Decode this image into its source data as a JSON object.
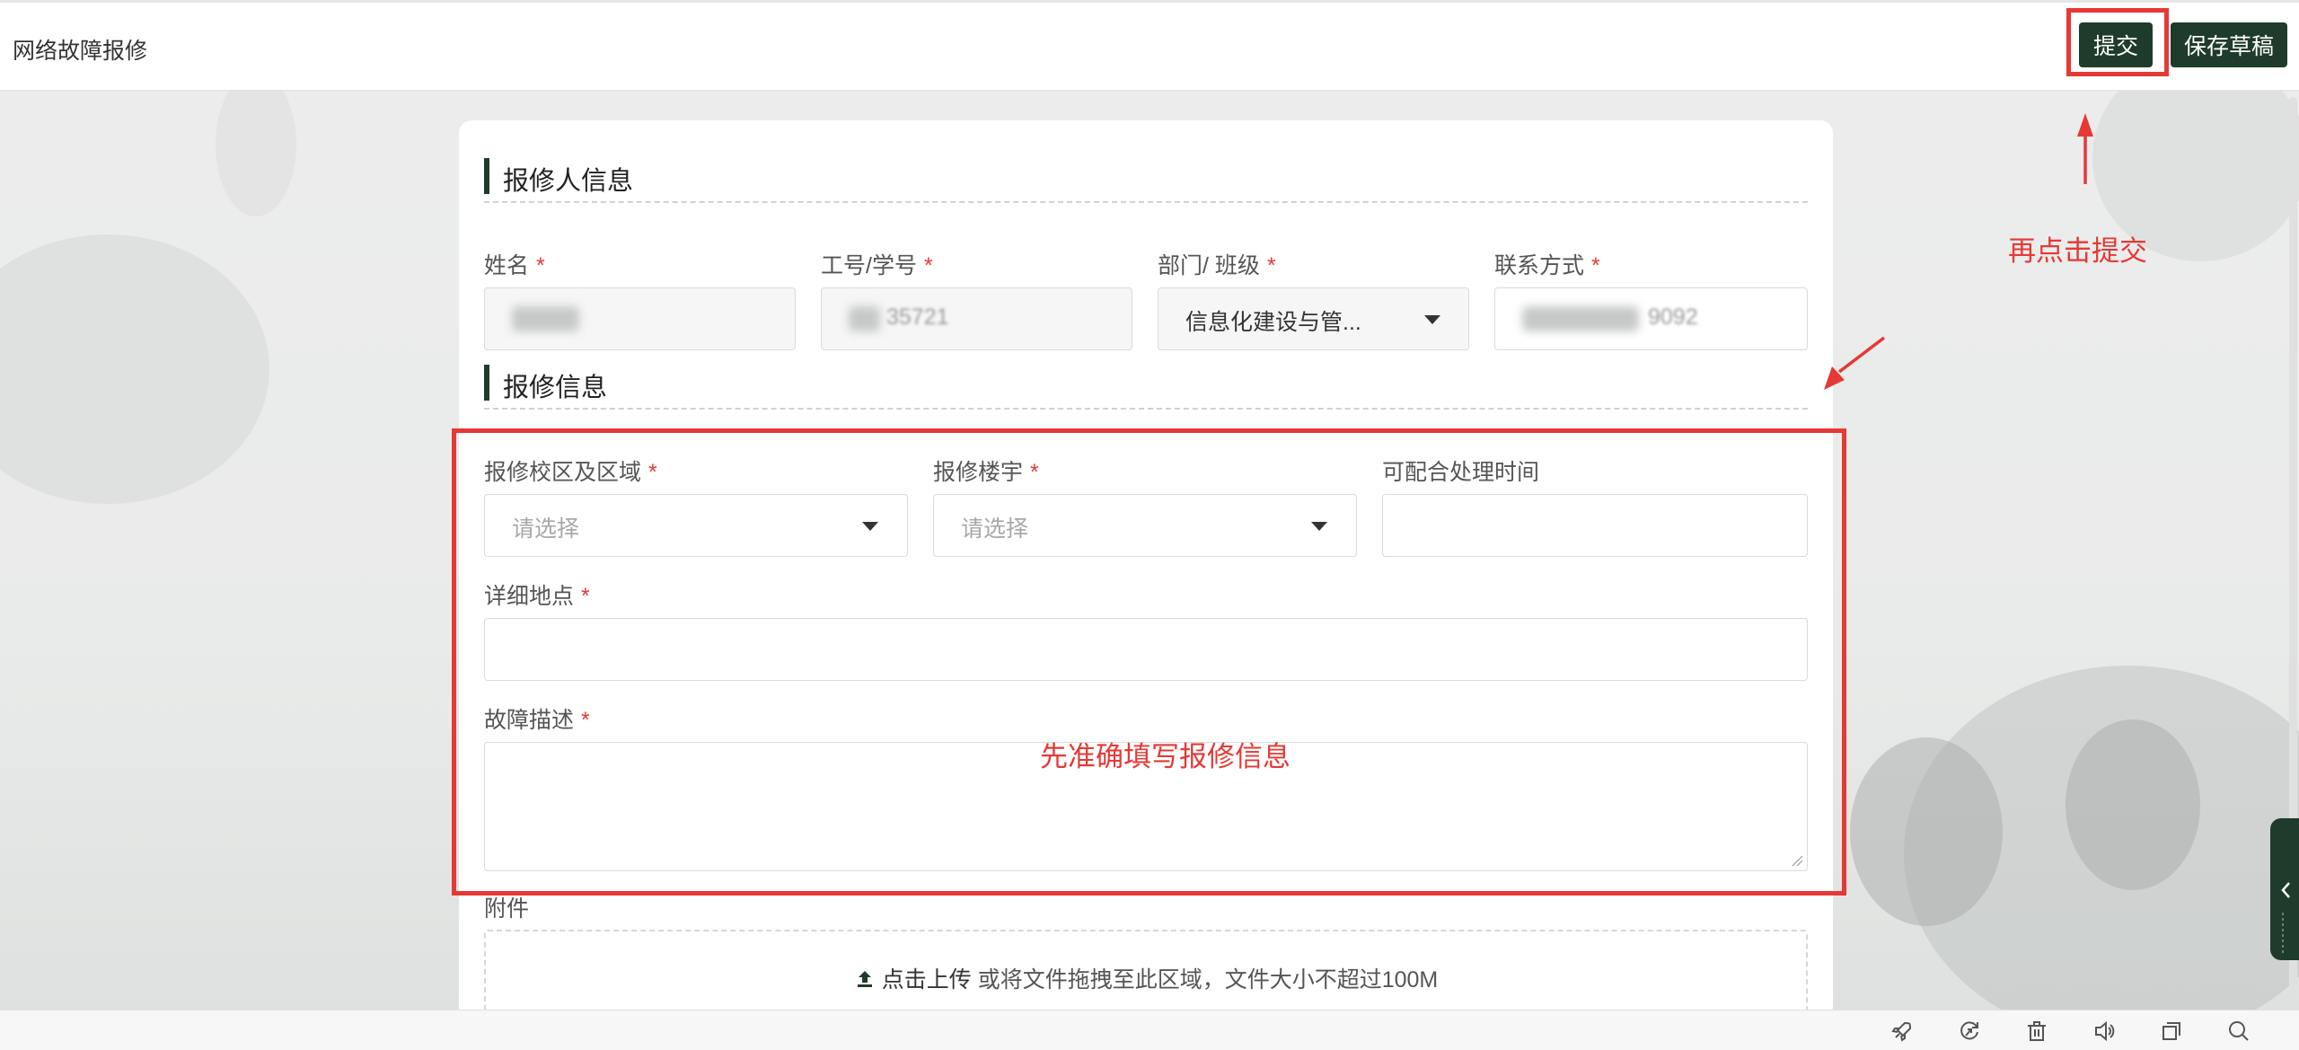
{
  "app": {
    "title": "网络故障报修"
  },
  "toolbar": {
    "submit_label": "提交",
    "draft_label": "保存草稿"
  },
  "sections": {
    "reporter_title": "报修人信息",
    "repair_title": "报修信息"
  },
  "reporter": {
    "name_label": "姓名",
    "id_label": "工号/学号",
    "id_partial": "35721",
    "dept_label": "部门/ 班级",
    "dept_value": "信息化建设与管...",
    "contact_label": "联系方式",
    "contact_partial": "9092",
    "required_mark": "*"
  },
  "repair": {
    "campus_label": "报修校区及区域",
    "campus_placeholder": "请选择",
    "building_label": "报修楼宇",
    "building_placeholder": "请选择",
    "time_label": "可配合处理时间",
    "location_label": "详细地点",
    "desc_label": "故障描述"
  },
  "attachment": {
    "label": "附件",
    "upload_action": "点击上传",
    "upload_hint": "或将文件拖拽至此区域，文件大小不超过100M"
  },
  "annotations": {
    "submit_hint": "再点击提交",
    "fill_hint": "先准确填写报修信息",
    "color": "#e53935"
  },
  "theme": {
    "accent": "#1f3b2b",
    "required": "#e53935"
  },
  "icons": {
    "bottom_bar": [
      "rocket-icon",
      "refresh-icon",
      "trash-icon",
      "speaker-icon",
      "copy-icon",
      "search-icon"
    ],
    "upload": "upload-icon",
    "side_tab": "chevron-left-icon"
  }
}
